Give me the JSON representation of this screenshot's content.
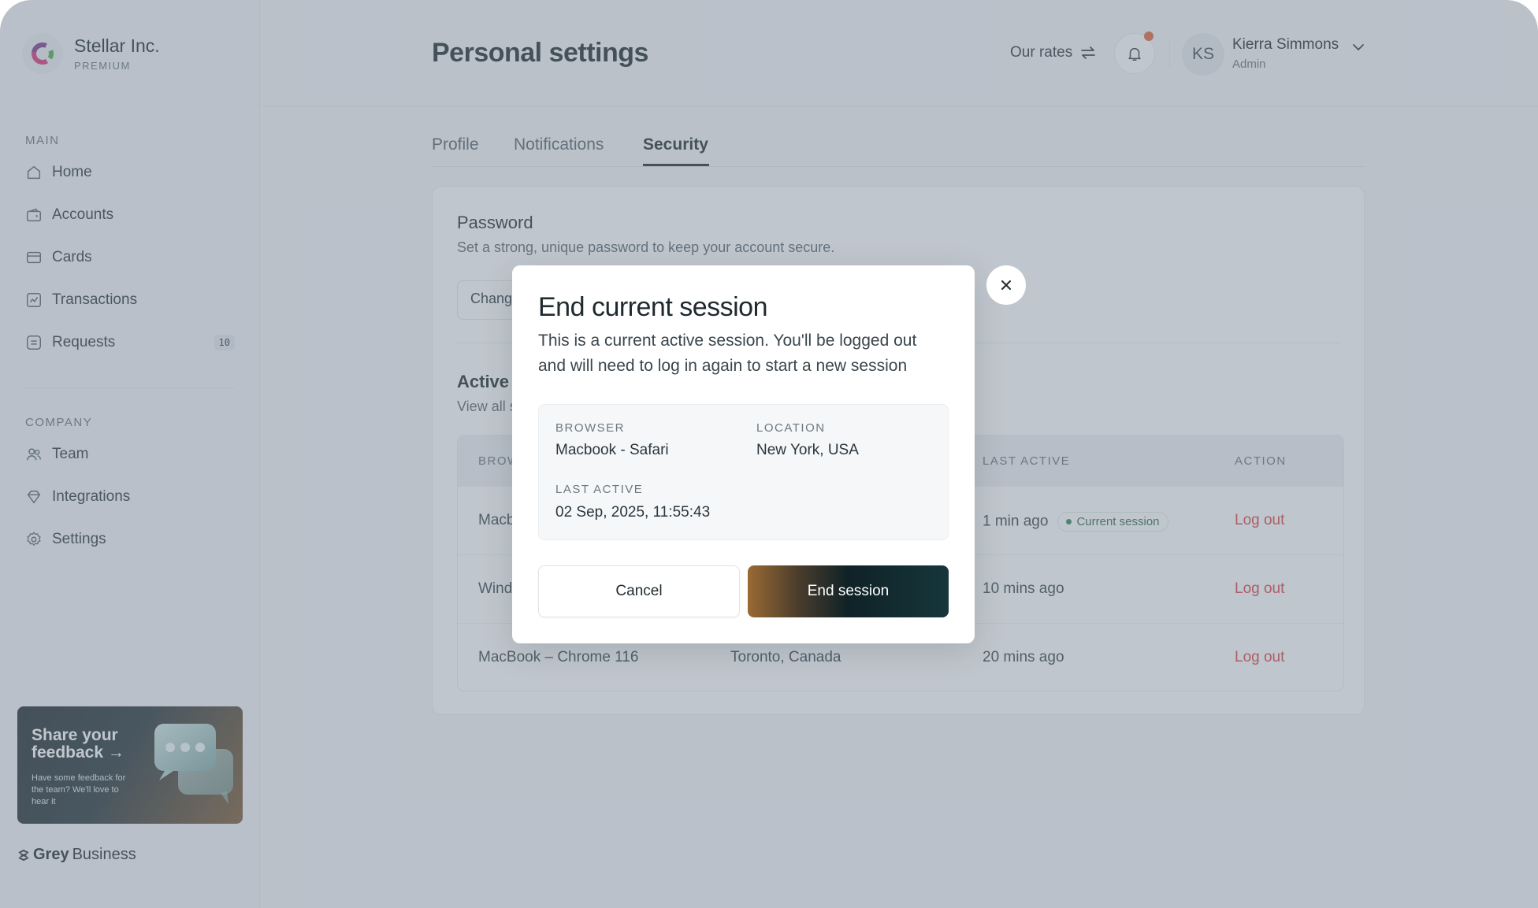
{
  "brand": {
    "name": "Stellar Inc.",
    "tier": "PREMIUM"
  },
  "sidebar": {
    "main_label": "MAIN",
    "main_items": [
      {
        "label": "Home",
        "icon": "home-icon"
      },
      {
        "label": "Accounts",
        "icon": "wallet-icon"
      },
      {
        "label": "Cards",
        "icon": "card-icon"
      },
      {
        "label": "Transactions",
        "icon": "chart-icon"
      },
      {
        "label": "Requests",
        "icon": "request-icon",
        "badge": "10"
      }
    ],
    "company_label": "COMPANY",
    "company_items": [
      {
        "label": "Team",
        "icon": "team-icon"
      },
      {
        "label": "Integrations",
        "icon": "integrations-icon"
      },
      {
        "label": "Settings",
        "icon": "gear-icon"
      }
    ],
    "promo": {
      "title": "Share your feedback →",
      "text": "Have some feedback for the team? We'll love to hear it"
    },
    "footer_logo": {
      "bold": "Grey",
      "rest": "Business"
    }
  },
  "header": {
    "title": "Personal settings",
    "rates": "Our rates",
    "user": {
      "initials": "KS",
      "name": "Kierra Simmons",
      "role": "Admin"
    }
  },
  "tabs": [
    {
      "label": "Profile",
      "active": false
    },
    {
      "label": "Notifications",
      "active": false
    },
    {
      "label": "Security",
      "active": true
    }
  ],
  "password": {
    "title": "Password",
    "subtitle": "Set a strong, unique password to keep your account secure.",
    "button": "Chang"
  },
  "sessions": {
    "title": "Active",
    "subtitle": "View all s",
    "columns": [
      "BROW",
      "LAST ACTIVE",
      "ACTION"
    ],
    "rows": [
      {
        "browser": "Macb",
        "location": "",
        "last_active": "1 min ago",
        "badge": "Current session",
        "action": "Log out"
      },
      {
        "browser": "Wind",
        "location": "",
        "last_active": "10 mins ago",
        "badge": "",
        "action": "Log out"
      },
      {
        "browser": "MacBook – Chrome 116",
        "location": "Toronto, Canada",
        "last_active": "20 mins ago",
        "badge": "",
        "action": "Log out"
      }
    ]
  },
  "modal": {
    "title": "End current session",
    "description": "This is a current active session. You'll be logged out and will need to log in again to start a new session",
    "browser_label": "BROWSER",
    "browser_value": "Macbook - Safari",
    "location_label": "LOCATION",
    "location_value": "New York, USA",
    "last_active_label": "LAST ACTIVE",
    "last_active_value": "02 Sep, 2025, 11:55:43",
    "cancel": "Cancel",
    "confirm": "End session"
  },
  "colors": {
    "danger": "#d64545",
    "success": "#2e8b57",
    "notification_dot": "#e0643c"
  }
}
